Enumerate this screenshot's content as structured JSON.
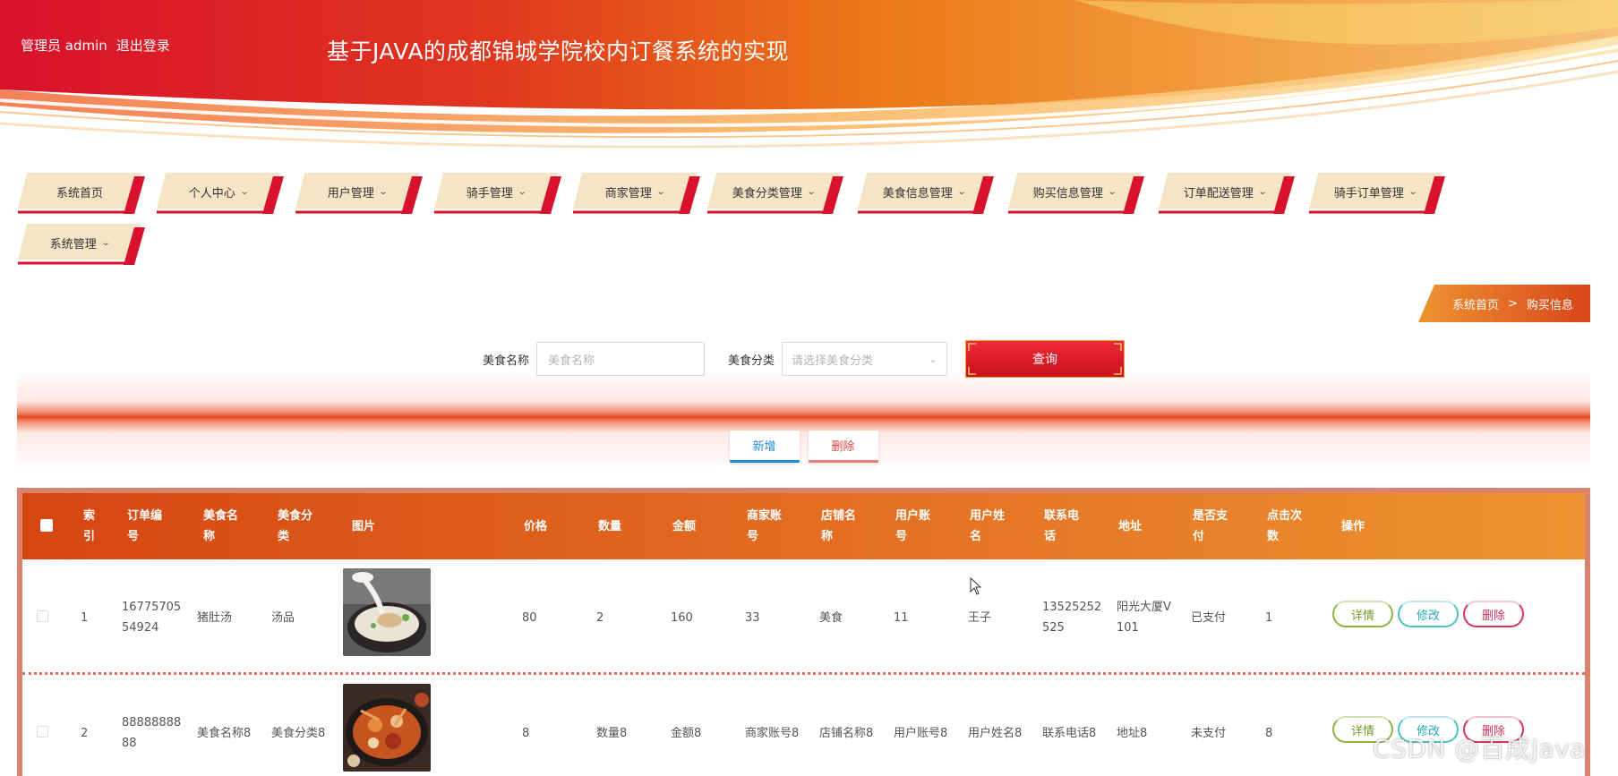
{
  "header": {
    "user_role": "管理员 admin",
    "logout": "退出登录",
    "title": "基于JAVA的成都锦城学院校内订餐系统的实现"
  },
  "nav": {
    "items": [
      {
        "label": "系统首页",
        "dropdown": false
      },
      {
        "label": "个人中心",
        "dropdown": true
      },
      {
        "label": "用户管理",
        "dropdown": true
      },
      {
        "label": "骑手管理",
        "dropdown": true
      },
      {
        "label": "商家管理",
        "dropdown": true
      },
      {
        "label": "美食分类管理",
        "dropdown": true
      },
      {
        "label": "美食信息管理",
        "dropdown": true
      },
      {
        "label": "购买信息管理",
        "dropdown": true
      },
      {
        "label": "订单配送管理",
        "dropdown": true
      },
      {
        "label": "骑手订单管理",
        "dropdown": true
      },
      {
        "label": "系统管理",
        "dropdown": true
      }
    ],
    "chevron": "⌄"
  },
  "breadcrumb": {
    "home": "系统首页",
    "separator": ">",
    "current": "购买信息"
  },
  "search": {
    "name_label": "美食名称",
    "name_placeholder": "美食名称",
    "category_label": "美食分类",
    "category_placeholder": "请选择美食分类",
    "query_button": "查询"
  },
  "actions": {
    "add": "新增",
    "delete": "删除"
  },
  "table": {
    "headers": {
      "index": [
        "索",
        "引"
      ],
      "order_no": [
        "订单编",
        "号"
      ],
      "food_name": [
        "美食名",
        "称"
      ],
      "food_category": [
        "美食分",
        "类"
      ],
      "image": [
        "图片"
      ],
      "price": [
        "价格"
      ],
      "quantity": [
        "数量"
      ],
      "amount": [
        "金额"
      ],
      "merchant_account": [
        "商家账",
        "号"
      ],
      "shop_name": [
        "店铺名",
        "称"
      ],
      "user_account": [
        "用户账",
        "号"
      ],
      "user_name": [
        "用户姓",
        "名"
      ],
      "phone": [
        "联系电",
        "话"
      ],
      "address": [
        "地址"
      ],
      "paid": [
        "是否支",
        "付"
      ],
      "clicks": [
        "点击次",
        "数"
      ],
      "ops": [
        "操作"
      ]
    },
    "rows": [
      {
        "index": "1",
        "order_no": [
          "16775705",
          "54924"
        ],
        "food_name": "猪肚汤",
        "food_category": "汤品",
        "price": "80",
        "quantity": "2",
        "amount": "160",
        "merchant_account": "33",
        "shop_name": "美食",
        "user_account": "11",
        "user_name": "王子",
        "phone": [
          "13525252",
          "525"
        ],
        "address": [
          "阳光大厦V",
          "101"
        ],
        "paid": "已支付",
        "clicks": "1"
      },
      {
        "index": "2",
        "order_no": [
          "88888888",
          "88"
        ],
        "food_name": "美食名称8",
        "food_category": "美食分类8",
        "price": "8",
        "quantity": "数量8",
        "amount": "金额8",
        "merchant_account": "商家账号8",
        "shop_name": "店铺名称8",
        "user_account": "用户账号8",
        "user_name": "用户姓名8",
        "phone": [
          "联系电话8"
        ],
        "address": [
          "地址8"
        ],
        "paid": "未支付",
        "clicks": "8"
      }
    ],
    "op_labels": {
      "detail": "详情",
      "edit": "修改",
      "delete": "删除"
    }
  },
  "watermark": "CSDN @百成Java",
  "colors": {
    "brand_red": "#d9112c",
    "brand_orange": "#e9751f",
    "header_gradient_end": "#ee9331",
    "nav_tab_fill": "#f6e4c6",
    "nav_accent": "#d9112c"
  }
}
